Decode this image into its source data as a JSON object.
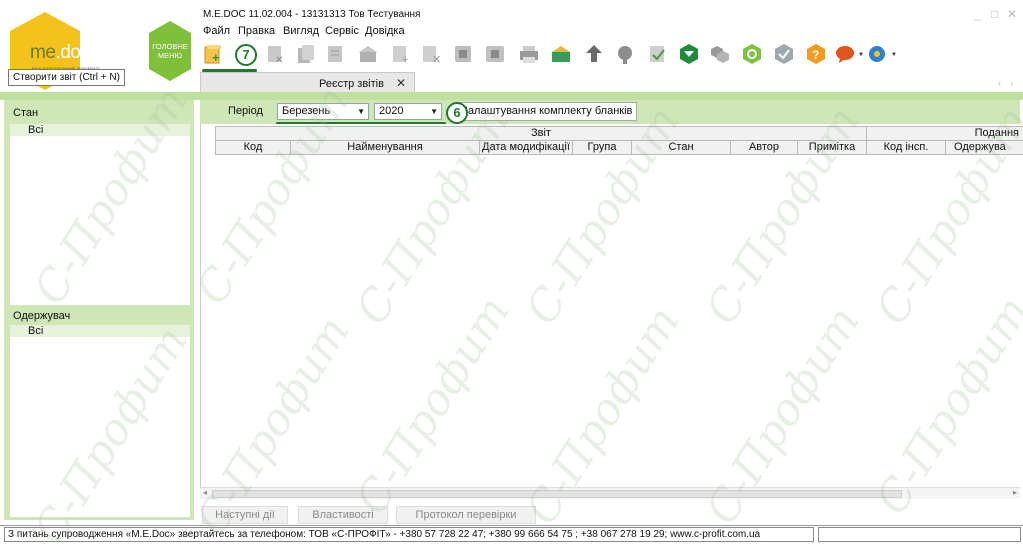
{
  "brand": {
    "logo_main": "me",
    "logo_doc": "doc",
    "logo_sub": "ВАШ ЕЛЕКТРОННИЙ ДОКУМЕНТ",
    "menu_label": "ГОЛОВНЕ МЕНЮ",
    "colors": {
      "logo_hex": "#f4c21c",
      "menu_hex": "#7fbf3a"
    }
  },
  "window": {
    "title": "M.E.DOC 11.02.004  - 13131313 Тов Тестування",
    "controls": [
      "_",
      "□",
      "✕"
    ]
  },
  "menu": [
    "Файл",
    "Правка",
    "Вигляд",
    "Сервіс",
    "Довідка"
  ],
  "toolbar": {
    "icons": [
      "new-report-icon",
      "callout-7",
      "delete-icon",
      "copy-icon",
      "edit-icon",
      "send-icon",
      "add-icon",
      "remove-icon",
      "close-doc-icon",
      "export-icon",
      "print-icon",
      "mail-icon",
      "upload-icon",
      "settings-icon",
      "check-icon",
      "filter-icon",
      "group-icon",
      "refresh-icon",
      "sign-icon",
      "help-icon",
      "chat-icon",
      "network-icon"
    ]
  },
  "tabs": {
    "active_label": "Реєстр звітів",
    "tooltip": "Створити звіт (Ctrl + N)",
    "callout_toolbar": "7"
  },
  "sidebar": {
    "state_title": "Стан",
    "state_all": "Всі",
    "receiver_title": "Одержувач",
    "receiver_all": "Всі"
  },
  "filter": {
    "period_label": "Період",
    "month_value": "Березень",
    "year_value": "2020",
    "settings_button": "Налаштування комплекту бланків",
    "callout": "6"
  },
  "table": {
    "group_headers": [
      "Звіт",
      "Подання"
    ],
    "columns": [
      "Код",
      "Найменування",
      "Дата модифікації",
      "Група",
      "Стан",
      "Автор",
      "Примітка",
      "Код інсп.",
      "Одержува"
    ]
  },
  "bottom_tabs": [
    "Наступні дії",
    "Властивості",
    "Протокол перевірки"
  ],
  "status": {
    "text": "З питань супроводження «M.E.Doc» звертайтесь за телефоном: ТОВ «С-ПРОФІТ» - +380 57 728 22 47; +380 99 666 54 75 ; +38 067 278 19 29; www.c-profit.com.ua"
  },
  "watermark": "С-Профит"
}
